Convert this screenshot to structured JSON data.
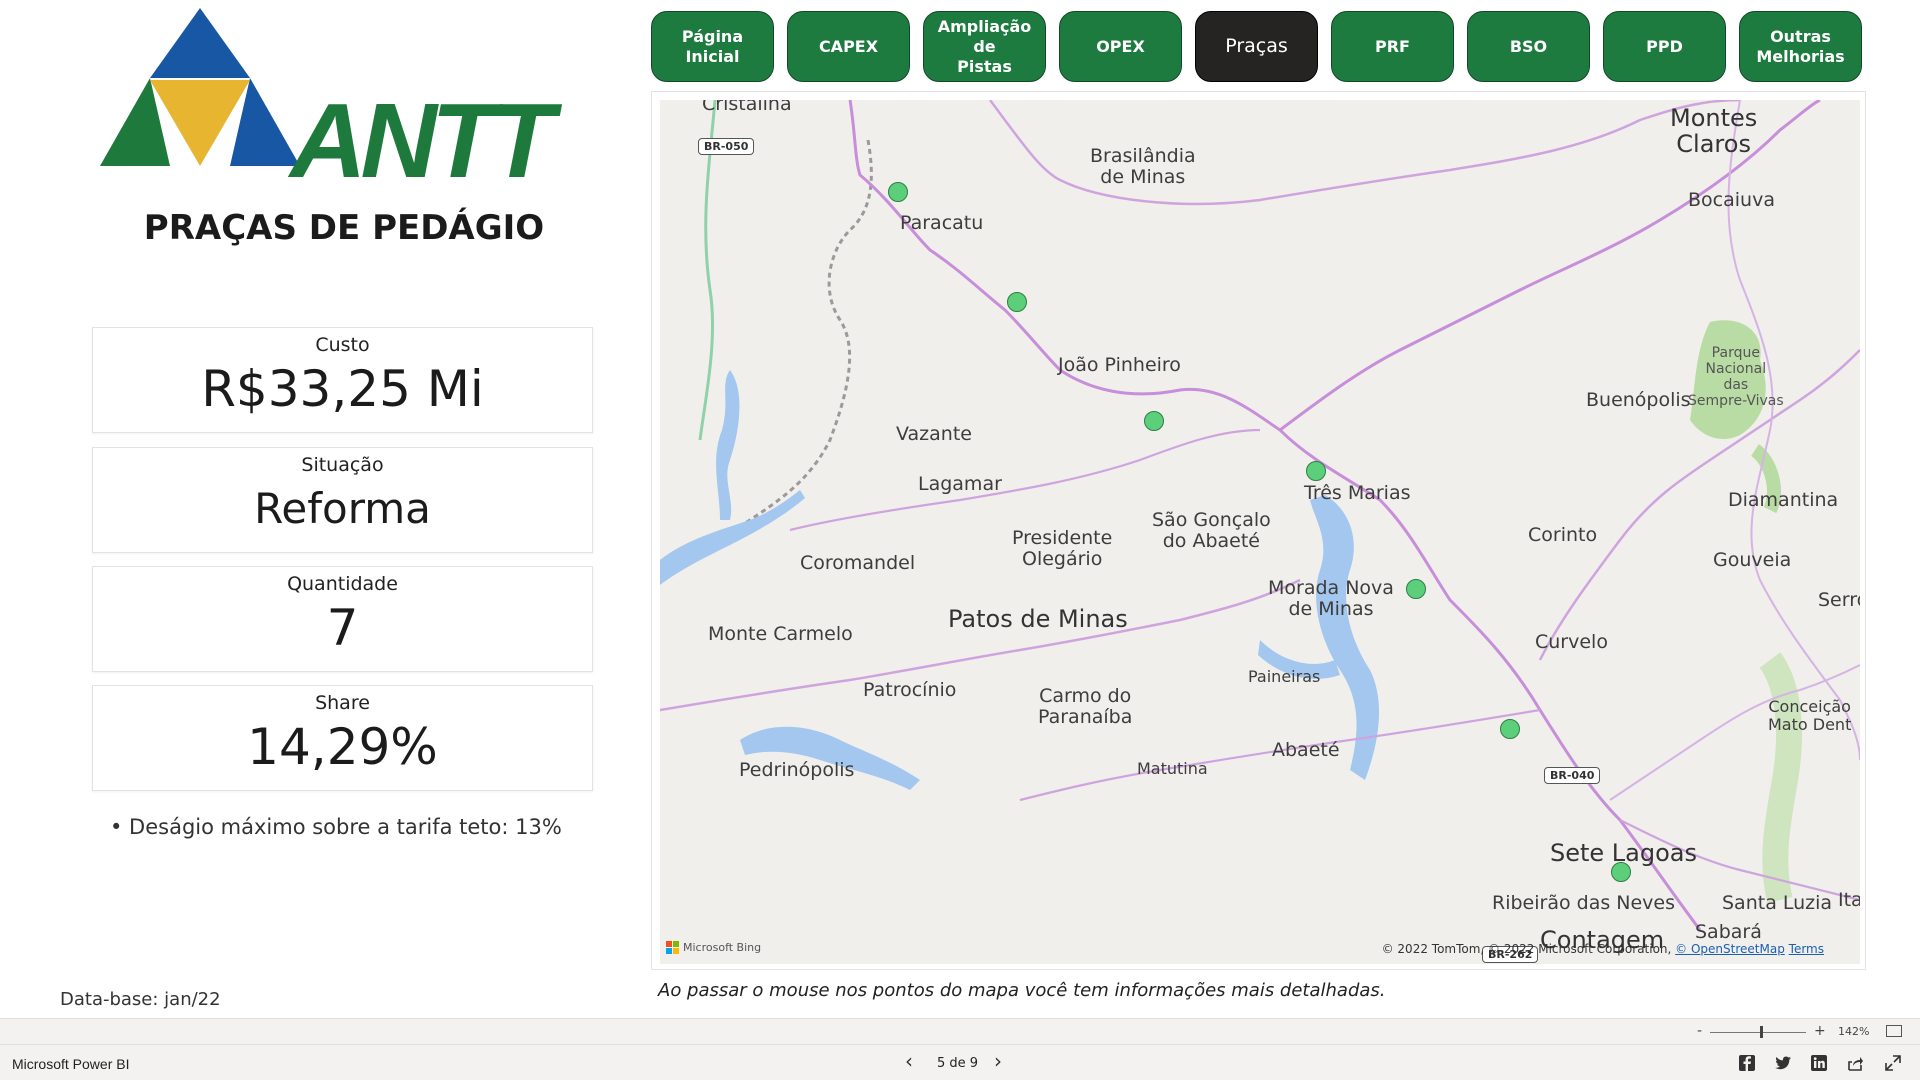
{
  "brand_name": "ANTT",
  "page_title": "PRAÇAS DE PEDÁGIO",
  "nav": [
    {
      "label": "Página Inicial",
      "active": false
    },
    {
      "label": "CAPEX",
      "active": false
    },
    {
      "label": "Ampliação de\nPistas",
      "active": false
    },
    {
      "label": "OPEX",
      "active": false
    },
    {
      "label": "Praças",
      "active": true
    },
    {
      "label": "PRF",
      "active": false
    },
    {
      "label": "BSO",
      "active": false
    },
    {
      "label": "PPD",
      "active": false
    },
    {
      "label": "Outras\nMelhorias",
      "active": false
    }
  ],
  "cards": [
    {
      "label": "Custo",
      "value": "R$33,25 Mi"
    },
    {
      "label": "Situação",
      "value": "Reforma"
    },
    {
      "label": "Quantidade",
      "value": "7"
    },
    {
      "label": "Share",
      "value": "14,29%"
    }
  ],
  "note": "• Deságio máximo sobre a tarifa teto: 13%",
  "database": "Data-base: jan/22",
  "hover_hint": "Ao passar o mouse nos pontos do mapa você tem informações mais detalhadas.",
  "map": {
    "places": [
      "Cristalina",
      "Brasilândia\nde Minas",
      "Montes\nClaros",
      "Bocaiuva",
      "Paracatu",
      "João Pinheiro",
      "Buenópolis",
      "Vazante",
      "Lagamar",
      "Três Marias",
      "Diamantina",
      "São Gonçalo\ndo Abaeté",
      "Presidente\nOlegário",
      "Coromandel",
      "Corinto",
      "Gouveia",
      "Morada Nova\nde Minas",
      "Patos de Minas",
      "Monte Carmelo",
      "Curvelo",
      "Serro",
      "Paineiras",
      "Patrocínio",
      "Carmo do\nParanaíba",
      "Conceição\nMato Dent",
      "Abaeté",
      "Pedrinópolis",
      "Matutina",
      "Sete Lagoas",
      "Ribeirão das Neves",
      "Santa Luzia",
      "Sabará",
      "Contagem",
      "Ita"
    ],
    "park": "Parque\nNacional\ndas\nSempre-Vivas",
    "shields": [
      "BR-050",
      "BR-040",
      "BR-262"
    ],
    "toll_point_count": 7,
    "attribution_prefix": "© 2022 TomTom, © 2022 Microsoft Corporation, ",
    "attribution_link": "© OpenStreetMap",
    "attribution_terms": "Terms",
    "provider": "Microsoft Bing"
  },
  "zoom": {
    "minus": "-",
    "plus": "+",
    "value": "142%"
  },
  "footer": {
    "app": "Microsoft Power BI",
    "page_indicator": "5 de 9"
  },
  "colors": {
    "brand_green": "#1e7b40",
    "active_button": "#252423",
    "toll_point": "#5ccf7a",
    "logo_blue": "#1857a4",
    "logo_yellow": "#e8b531"
  }
}
